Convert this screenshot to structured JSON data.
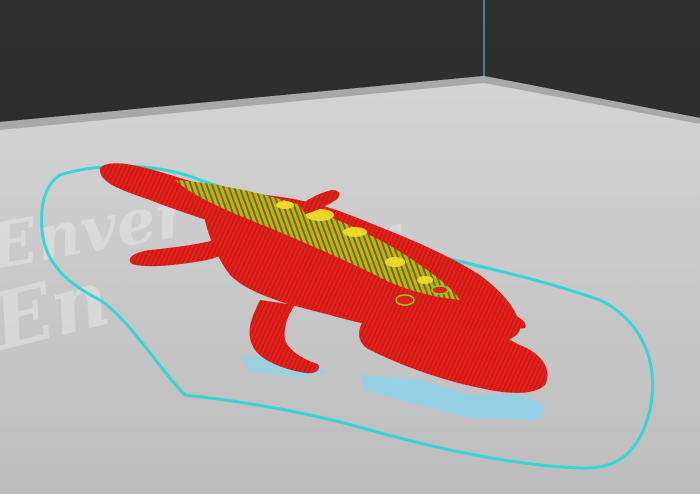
{
  "viewport": {
    "background_color": "#2b2b2b",
    "wall_line_color": "#5fd3e0"
  },
  "build_plate": {
    "surface_color": "#c9c9c9",
    "edge_color": "#a8a8a8",
    "watermark_text": "Enver",
    "watermark_color": "#e6e6e6"
  },
  "model": {
    "subject": "crocodile",
    "outer_wall_color": "#e3201b",
    "inner_wall_color": "#7ed321",
    "infill_color": "#f2e12a",
    "support_color": "#8fd3e8"
  },
  "skirt": {
    "color": "#35d6d6"
  }
}
